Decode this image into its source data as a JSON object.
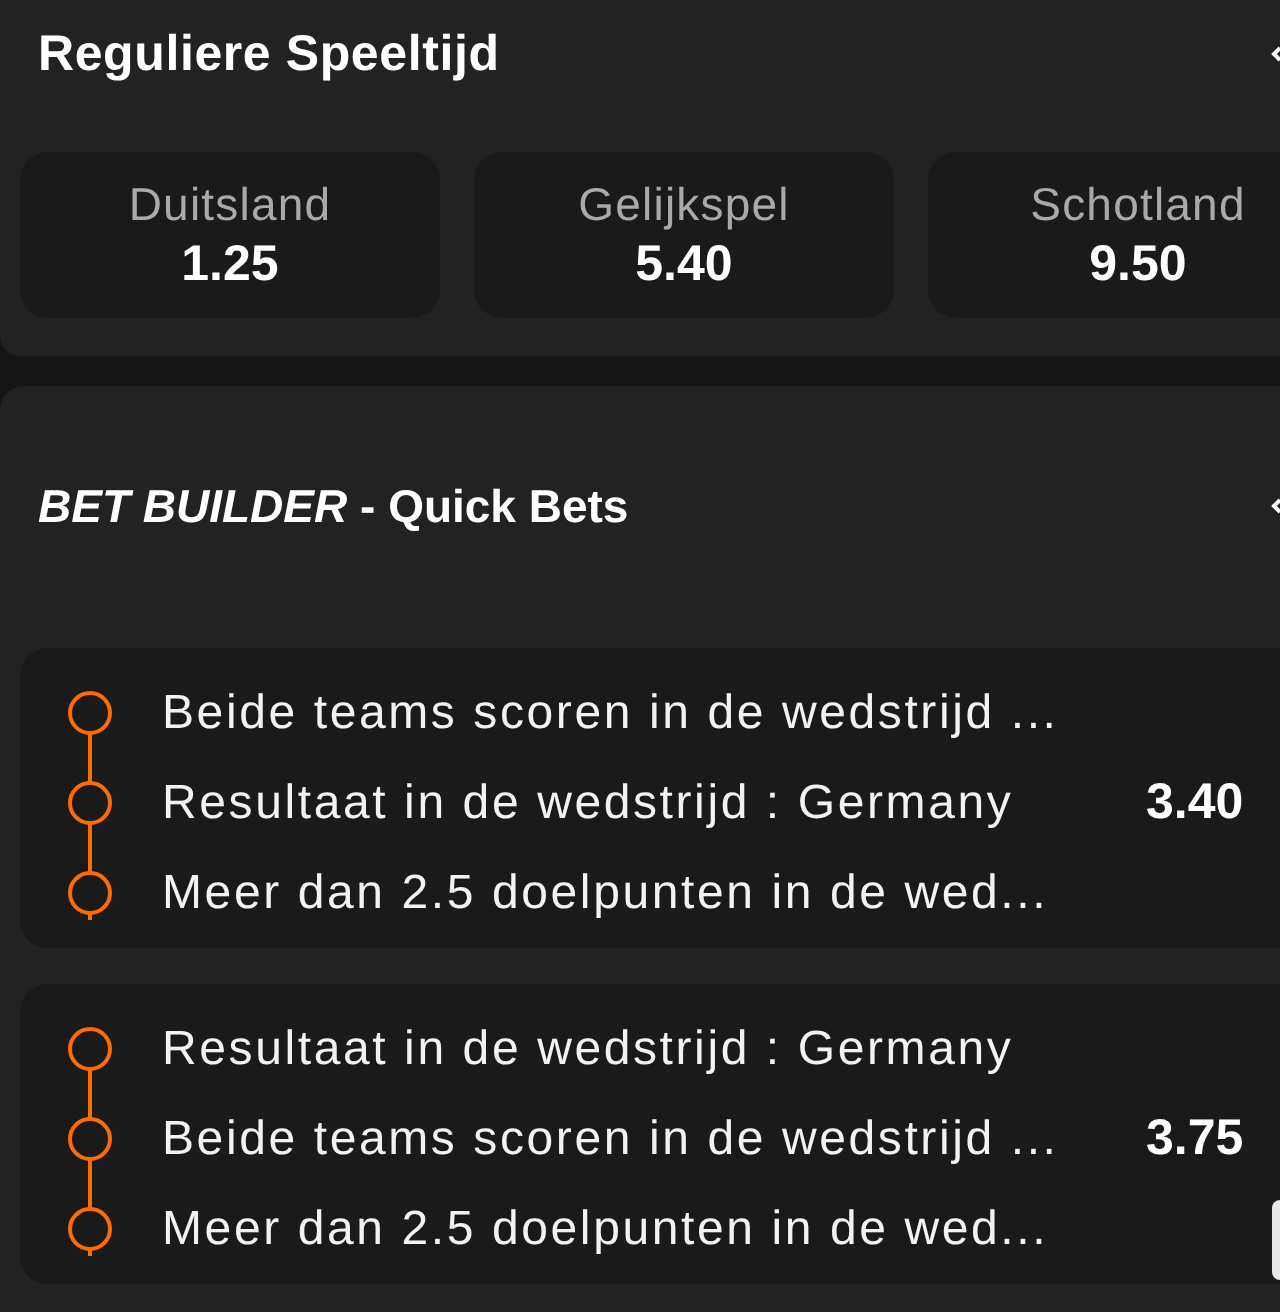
{
  "match_result": {
    "title": "Reguliere Speeltijd",
    "outcomes": [
      {
        "label": "Duitsland",
        "odds": "1.25"
      },
      {
        "label": "Gelijkspel",
        "odds": "5.40"
      },
      {
        "label": "Schotland",
        "odds": "9.50"
      }
    ]
  },
  "bet_builder": {
    "title": "*BET BUILDER* - Quick Bets",
    "combos": [
      {
        "legs": [
          "Beide teams scoren in de wedstrijd ...",
          "Resultaat in de wedstrijd : Germany",
          "Meer dan 2.5 doelpunten in de wed..."
        ],
        "odds": "3.40"
      },
      {
        "legs": [
          "Resultaat in de wedstrijd : Germany",
          "Beide teams scoren in de wedstrijd ...",
          "Meer dan 2.5 doelpunten in de wed..."
        ],
        "odds": "3.75"
      }
    ]
  }
}
